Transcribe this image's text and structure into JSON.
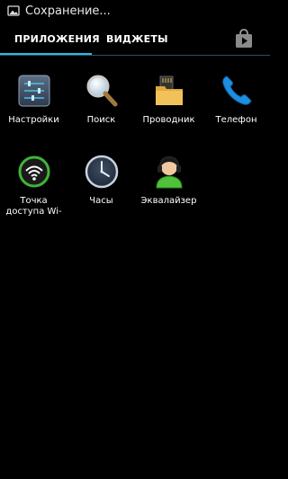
{
  "status_bar": {
    "notification_icon": "image-icon",
    "text": "Сохранение..."
  },
  "tabs": [
    {
      "label": "ПРИЛОЖЕНИЯ",
      "active": true
    },
    {
      "label": "ВИДЖЕТЫ",
      "active": false
    }
  ],
  "store_button": {
    "icon": "play-store-icon"
  },
  "accent_color": "#33b5e5",
  "apps": [
    {
      "label": "Настройки",
      "icon": "settings-icon"
    },
    {
      "label": "Поиск",
      "icon": "search-icon"
    },
    {
      "label": "Проводник",
      "icon": "file-manager-icon"
    },
    {
      "label": "Телефон",
      "icon": "phone-icon"
    },
    {
      "label": "Точка доступа Wi-",
      "icon": "wifi-hotspot-icon"
    },
    {
      "label": "Часы",
      "icon": "clock-icon"
    },
    {
      "label": "Эквалайзер",
      "icon": "equalizer-icon"
    }
  ]
}
